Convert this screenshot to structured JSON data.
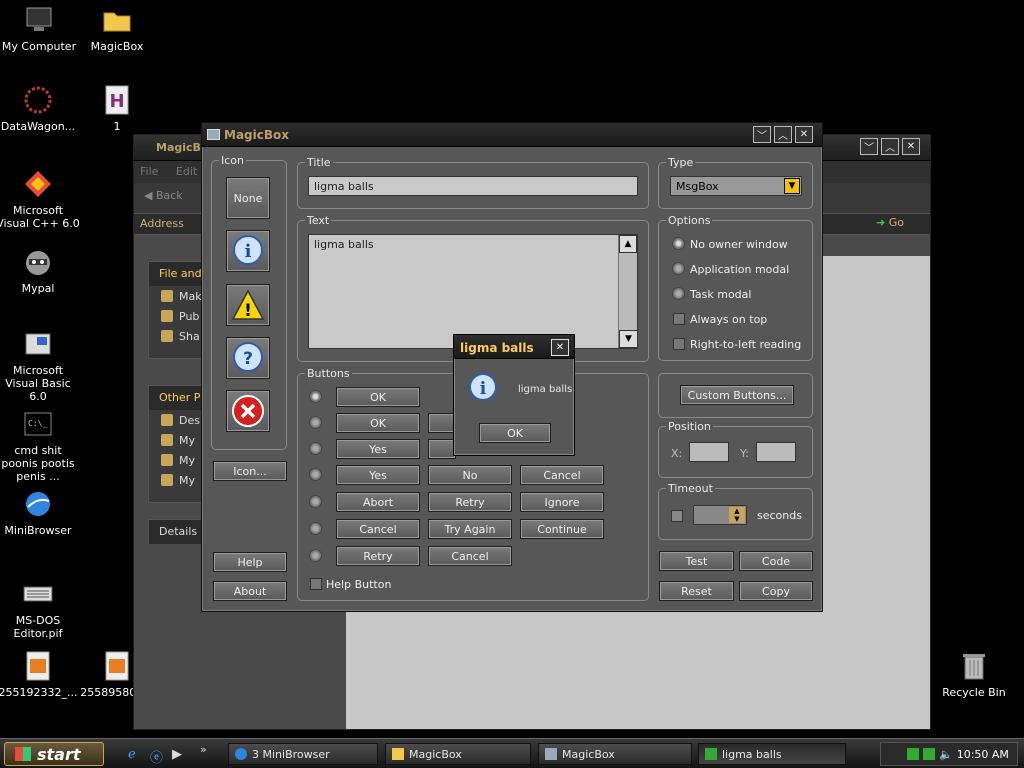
{
  "desktop": {
    "icons": [
      {
        "label": "My Computer",
        "glyph": "monitor-icon"
      },
      {
        "label": "MagicBox",
        "glyph": "folder-icon"
      },
      {
        "label": "DataWagon...",
        "glyph": "datawagon-icon"
      },
      {
        "label": "1",
        "glyph": "h-document-icon"
      },
      {
        "label": "Microsoft Visual C++ 6.0",
        "glyph": "vcpp-icon"
      },
      {
        "label": "Mypal",
        "glyph": "raccoon-icon"
      },
      {
        "label": "Microsoft Visual Basic 6.0",
        "glyph": "vb-icon"
      },
      {
        "label": "cmd shit poonis pootis penis ...",
        "glyph": "cmd-icon"
      },
      {
        "label": "MiniBrowser",
        "glyph": "globe-icon"
      },
      {
        "label": "MS-DOS Editor.pif",
        "glyph": "keyboard-icon"
      },
      {
        "label": "255192332_...",
        "glyph": "image-file-icon"
      },
      {
        "label": "255895805...",
        "glyph": "image-file-icon"
      },
      {
        "label": "Recycle Bin",
        "glyph": "recycle-bin-icon"
      }
    ]
  },
  "explorer": {
    "title": "MagicBox",
    "menus": [
      "File",
      "Edit"
    ],
    "back_label": "Back",
    "address_label": "Address",
    "go_label": "Go",
    "tasks_file_header": "File and",
    "tasks_file_items": [
      "Mak",
      "Pub We",
      "Sha"
    ],
    "tasks_other_header": "Other P",
    "tasks_other_items": [
      "Des",
      "My",
      "My",
      "My"
    ],
    "details_header": "Details"
  },
  "magic": {
    "title": "MagicBox",
    "icon_group": "Icon",
    "icon_none": "None",
    "icon_button": "Icon...",
    "help_button": "Help",
    "about_button": "About",
    "title_group": "Title",
    "title_value": "ligma balls",
    "text_group": "Text",
    "text_value": "ligma balls",
    "type_group": "Type",
    "type_value": "MsgBox",
    "options_group": "Options",
    "options": [
      "No owner window",
      "Application modal",
      "Task modal",
      "Always on top",
      "Right-to-left reading"
    ],
    "buttons_group": "Buttons",
    "button_rows": [
      [
        "OK"
      ],
      [
        "OK",
        ""
      ],
      [
        "Yes",
        ""
      ],
      [
        "Yes",
        "No",
        "Cancel"
      ],
      [
        "Abort",
        "Retry",
        "Ignore"
      ],
      [
        "Cancel",
        "Try Again",
        "Continue"
      ],
      [
        "Retry",
        "Cancel"
      ]
    ],
    "help_checkbox": "Help Button",
    "custom_buttons": "Custom Buttons...",
    "position_group": "Position",
    "pos_x_label": "X:",
    "pos_y_label": "Y:",
    "timeout_group": "Timeout",
    "seconds_label": "seconds",
    "test_button": "Test",
    "code_button": "Code",
    "reset_button": "Reset",
    "copy_button": "Copy"
  },
  "msgbox": {
    "title": "ligma balls",
    "message": "ligma balls",
    "ok": "OK"
  },
  "taskbar": {
    "start": "start",
    "tasks": [
      "3 MiniBrowser",
      "MagicBox",
      "MagicBox",
      "ligma balls"
    ],
    "clock": "10:50 AM"
  }
}
